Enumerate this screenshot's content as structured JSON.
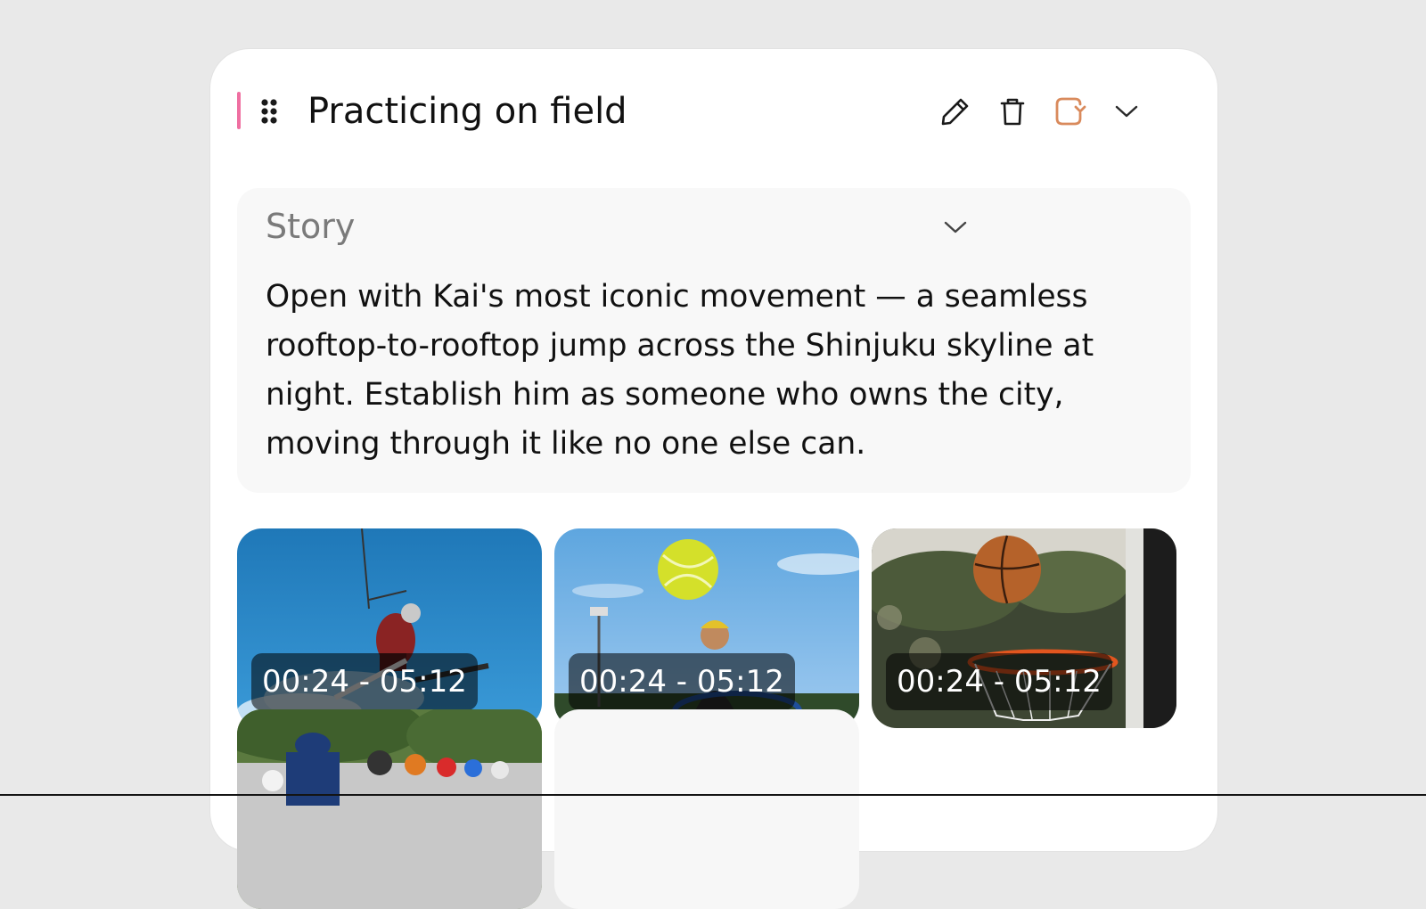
{
  "section": {
    "title": "Practicing on field",
    "accent_color": "#ef6fa1",
    "actions": [
      {
        "name": "edit",
        "icon": "pencil-icon"
      },
      {
        "name": "delete",
        "icon": "trash-icon"
      },
      {
        "name": "regenerate",
        "icon": "refresh-icon",
        "color": "#d98a5c"
      },
      {
        "name": "collapse",
        "icon": "chevron-down-icon"
      }
    ]
  },
  "story": {
    "label": "Story",
    "text": "Open with Kai's most iconic movement — a seamless rooftop-to-rooftop jump across the Shinjuku skyline at night. Establish him as someone who owns the city, moving through it like no one else can."
  },
  "clips": [
    {
      "scene": "skier",
      "time_range": "00:24 - 05:12"
    },
    {
      "scene": "tennis",
      "time_range": "00:24 - 05:12"
    },
    {
      "scene": "basketball",
      "time_range": "00:24 - 05:12"
    },
    {
      "scene": "cycling"
    },
    {
      "scene": "placeholder"
    }
  ]
}
